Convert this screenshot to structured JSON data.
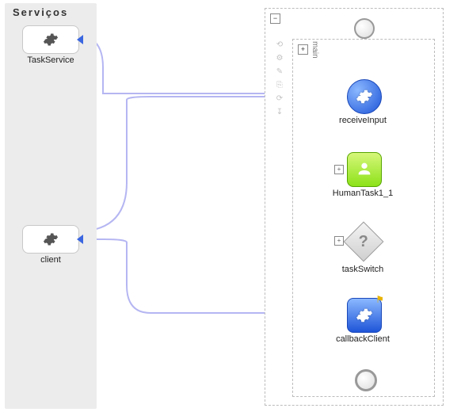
{
  "services_panel": {
    "title": "Serviços",
    "task_service": {
      "label": "TaskService"
    },
    "client": {
      "label": "client"
    }
  },
  "process": {
    "outer_toggle": "−",
    "inner_toggle": "+",
    "inner_label": "main",
    "nodes": {
      "receive": {
        "label": "receiveInput"
      },
      "humantask": {
        "label": "HumanTask1_1"
      },
      "switch": {
        "label": "taskSwitch"
      },
      "callback": {
        "label": "callbackClient"
      }
    }
  },
  "toolbar": {
    "items": [
      "⟲",
      "⚙",
      "✎",
      "⎘",
      "⟳",
      "↧"
    ]
  },
  "chart_data": {
    "type": "bpel-process-diagram",
    "partner_links": [
      {
        "name": "TaskService",
        "role": "service"
      },
      {
        "name": "client",
        "role": "client"
      }
    ],
    "flow": [
      {
        "id": "start",
        "type": "start-event"
      },
      {
        "id": "receiveInput",
        "type": "receive",
        "partnerLink": "client"
      },
      {
        "id": "HumanTask1_1",
        "type": "human-task",
        "partnerLink": "TaskService"
      },
      {
        "id": "taskSwitch",
        "type": "switch"
      },
      {
        "id": "callbackClient",
        "type": "invoke-callback",
        "partnerLink": "client"
      },
      {
        "id": "end",
        "type": "end-event"
      }
    ],
    "edges": [
      [
        "start",
        "receiveInput"
      ],
      [
        "receiveInput",
        "HumanTask1_1"
      ],
      [
        "HumanTask1_1",
        "taskSwitch"
      ],
      [
        "taskSwitch",
        "callbackClient"
      ],
      [
        "callbackClient",
        "end"
      ]
    ],
    "message_links": [
      {
        "from": "TaskService",
        "to": "receiveInput"
      },
      {
        "from": "client",
        "to": "receiveInput"
      },
      {
        "from": "client",
        "to": "callbackClient"
      }
    ]
  }
}
